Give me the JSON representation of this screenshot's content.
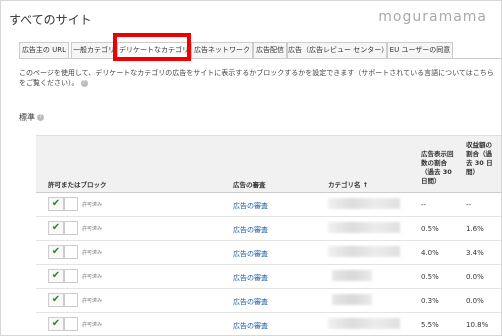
{
  "page": {
    "title": "すべてのサイト",
    "watermark": "moguramama"
  },
  "tabs": [
    {
      "label": "広告主の URL"
    },
    {
      "label": "一般カテゴリ"
    },
    {
      "label": "デリケートなカテゴリ"
    },
    {
      "label": "広告ネットワーク"
    },
    {
      "label": "広告配信"
    },
    {
      "label": "広告（広告レビュー センター）"
    },
    {
      "label": "EU ユーザーの同意"
    }
  ],
  "active_tab": "デリケートなカテゴリ",
  "description": "このページを使用して、デリケートなカテゴリの広告をサイトに表示するかブロックするかを設定できます（サポートされている言語についてはこちらをご覧ください）。",
  "section_title": "標準",
  "table": {
    "headers": {
      "allow_block": "許可またはブロック",
      "review": "広告の審査",
      "category": "カテゴリ名 ↑",
      "impressions": "広告表示回数の割合（過去 30 日間）",
      "earnings": "収益額の割合（過去 30 日間）"
    },
    "rows": [
      {
        "status": "許可済み",
        "review": "広告の審査",
        "impressions": "--",
        "earnings": "--"
      },
      {
        "status": "許可済み",
        "review": "広告の審査",
        "impressions": "0.5%",
        "earnings": "1.6%"
      },
      {
        "status": "許可済み",
        "review": "広告の審査",
        "impressions": "4.0%",
        "earnings": "3.4%"
      },
      {
        "status": "許可済み",
        "review": "広告の審査",
        "impressions": "0.5%",
        "earnings": "0.0%"
      },
      {
        "status": "許可済み",
        "review": "広告の審査",
        "impressions": "0.3%",
        "earnings": "0.0%"
      },
      {
        "status": "許可済み",
        "review": "広告の審査",
        "impressions": "5.5%",
        "earnings": "10.8%"
      }
    ]
  },
  "colors": {
    "highlight": "#e00000",
    "link": "#1a5fa8",
    "check": "#2a8a2a"
  }
}
